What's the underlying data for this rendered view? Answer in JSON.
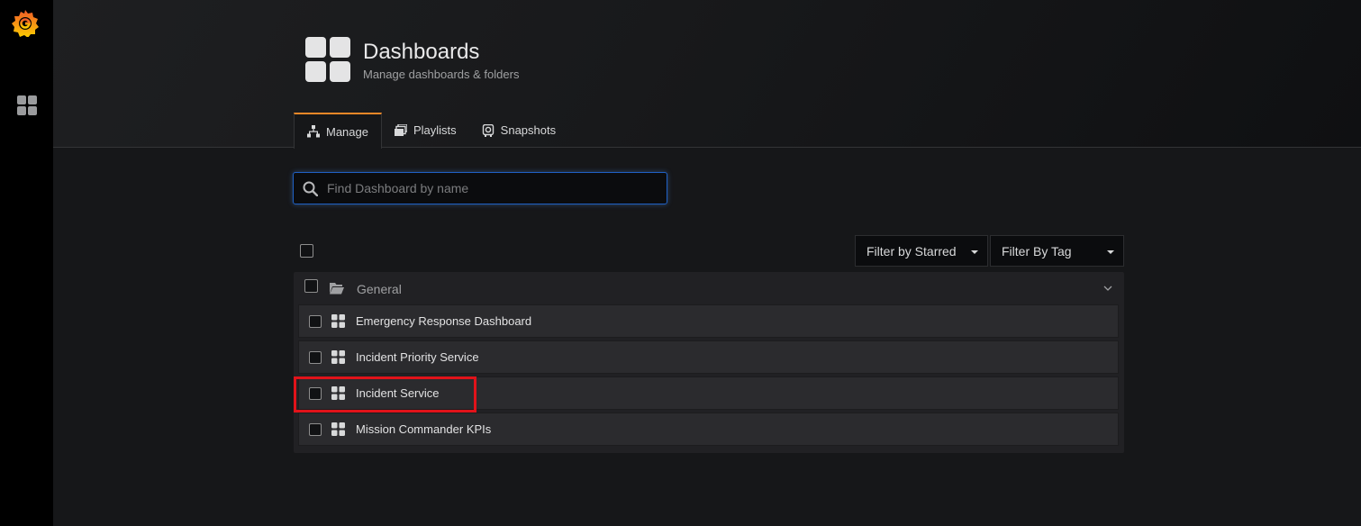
{
  "sidebar": {
    "logo_icon": "grafana-logo-icon",
    "items": [
      {
        "icon": "dashboards-grid-icon"
      }
    ]
  },
  "header": {
    "icon": "dashboards-grid-icon",
    "title": "Dashboards",
    "subtitle": "Manage dashboards & folders",
    "tabs": [
      {
        "label": "Manage",
        "icon": "sitemap-icon",
        "active": true
      },
      {
        "label": "Playlists",
        "icon": "playlist-icon",
        "active": false
      },
      {
        "label": "Snapshots",
        "icon": "camera-icon",
        "active": false
      }
    ]
  },
  "search": {
    "placeholder": "Find Dashboard by name",
    "value": ""
  },
  "filters": {
    "starred": "Filter by Starred",
    "tag": "Filter By Tag"
  },
  "folder": {
    "name": "General",
    "dashboards": [
      {
        "title": "Emergency Response Dashboard"
      },
      {
        "title": "Incident Priority Service"
      },
      {
        "title": "Incident Service"
      },
      {
        "title": "Mission Commander KPIs"
      }
    ]
  },
  "colors": {
    "accent": "#f08727",
    "highlight": "#e1131a",
    "focus": "#1f60c4"
  }
}
